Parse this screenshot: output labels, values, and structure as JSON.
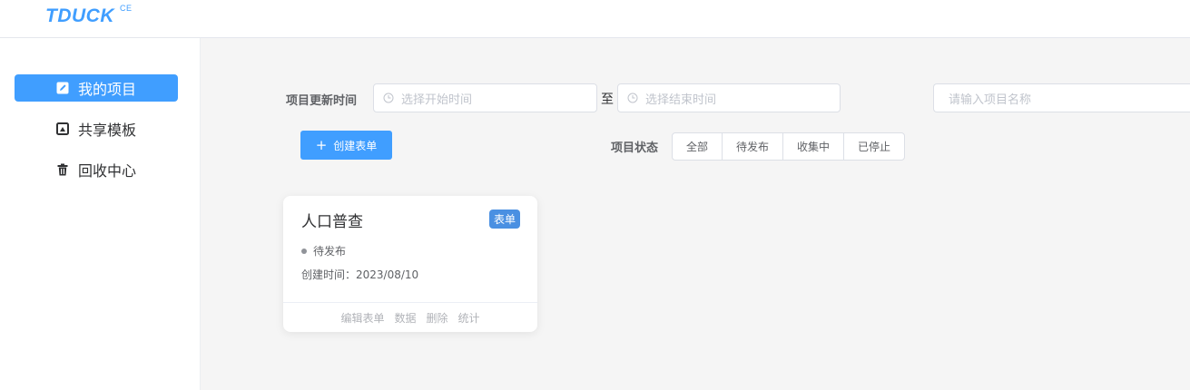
{
  "app": {
    "logo": "TDUCK",
    "logo_sup": "CE"
  },
  "sidebar": {
    "items": [
      {
        "label": "我的项目",
        "icon": "edit-icon",
        "active": true
      },
      {
        "label": "共享模板",
        "icon": "template-icon",
        "active": false
      },
      {
        "label": "回收中心",
        "icon": "trash-icon",
        "active": false
      }
    ]
  },
  "filters": {
    "update_time_label": "项目更新时间",
    "start_placeholder": "选择开始时间",
    "to_text": "至",
    "end_placeholder": "选择结束时间",
    "search_placeholder": "请输入项目名称",
    "status_label": "项目状态",
    "status_options": [
      "全部",
      "待发布",
      "收集中",
      "已停止"
    ]
  },
  "create_button": {
    "label": "创建表单",
    "icon": "plus-icon"
  },
  "projects": [
    {
      "title": "人口普查",
      "tag": "表单",
      "status": "待发布",
      "created": "创建时间：2023/08/10",
      "actions": [
        "编辑表单",
        "数据",
        "删除",
        "统计"
      ]
    }
  ],
  "colors": {
    "accent": "#409eff",
    "tag": "#4a90e2",
    "muted": "#b1b3b8"
  }
}
